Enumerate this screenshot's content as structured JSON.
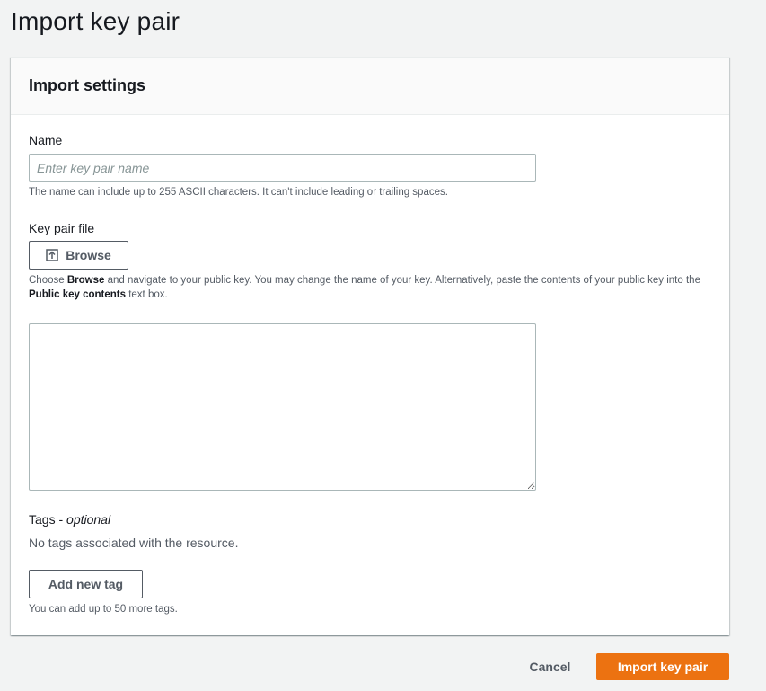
{
  "page": {
    "title": "Import key pair"
  },
  "panel": {
    "title": "Import settings",
    "name_field": {
      "label": "Name",
      "placeholder": "Enter key pair name",
      "value": "",
      "hint": "The name can include up to 255 ASCII characters. It can't include leading or trailing spaces."
    },
    "key_file": {
      "label": "Key pair file",
      "browse_label": "Browse",
      "browse_icon": "upload-icon",
      "hint_prefix": "Choose ",
      "hint_browse": "Browse",
      "hint_middle": " and navigate to your public key. You may change the name of your key. Alternatively, paste the contents of your public key into the ",
      "hint_contents": "Public key contents",
      "hint_suffix": " text box.",
      "contents_value": ""
    },
    "tags": {
      "label": "Tags",
      "label_suffix": " - ",
      "optional": "optional",
      "empty_text": "No tags associated with the resource.",
      "add_label": "Add new tag",
      "limit_hint": "You can add up to 50 more tags."
    }
  },
  "footer": {
    "cancel_label": "Cancel",
    "submit_label": "Import key pair"
  },
  "colors": {
    "primary": "#ec7211",
    "text": "#16191f",
    "secondary_text": "#545b64",
    "background": "#f2f3f3"
  }
}
